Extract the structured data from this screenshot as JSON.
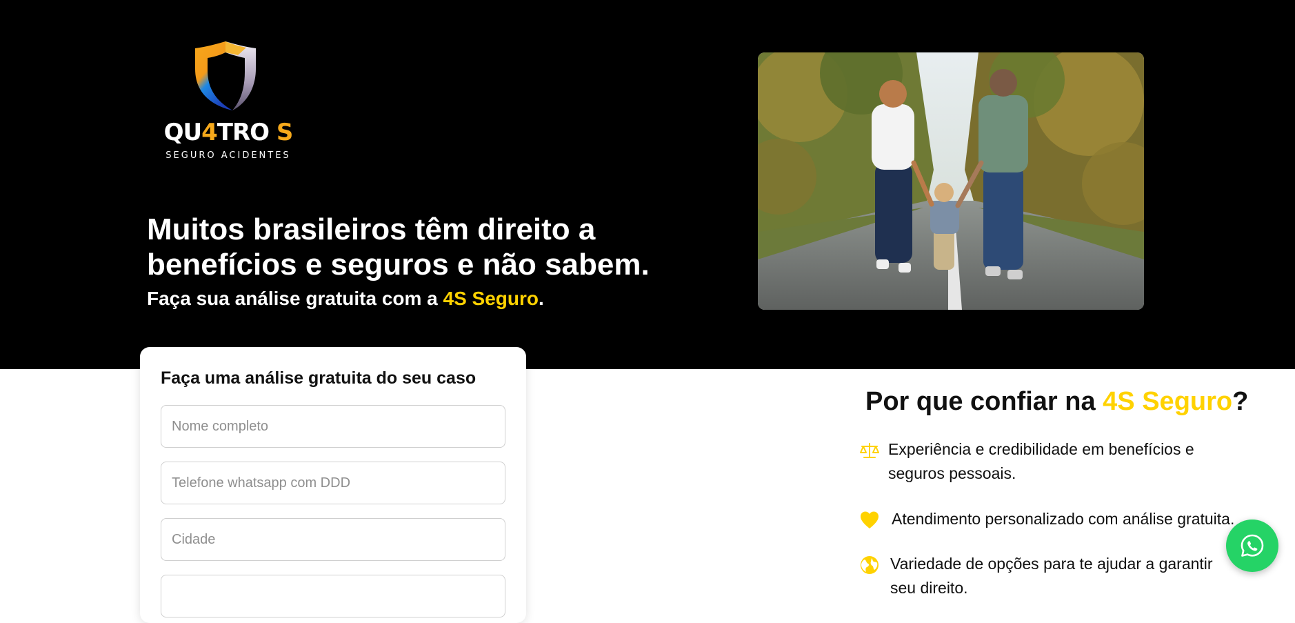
{
  "brand": {
    "logo_word_prefix": "QU",
    "logo_word_accent": "4",
    "logo_word_middle": "TRO ",
    "logo_word_suffix": "S",
    "logo_tagline": "SEGURO ACIDENTES"
  },
  "hero": {
    "headline": "Muitos brasileiros têm direito a benefícios e seguros e não sabem.",
    "subline_prefix": "Faça sua análise gratuita com a ",
    "subline_brand": "4S Seguro",
    "subline_suffix": ".",
    "photo_description": "family-walking-road-photo"
  },
  "form": {
    "title": "Faça uma análise gratuita do seu caso",
    "fields": [
      {
        "placeholder": "Nome completo",
        "value": ""
      },
      {
        "placeholder": "Telefone whatsapp com DDD",
        "value": ""
      },
      {
        "placeholder": "Cidade",
        "value": ""
      },
      {
        "placeholder": "",
        "value": ""
      }
    ]
  },
  "why": {
    "title_prefix": "Por que confiar na ",
    "title_brand": "4S Seguro",
    "title_suffix": "?",
    "items": [
      {
        "icon": "scale-icon",
        "text": "Experiência e credibilidade em benefícios e seguros pessoais."
      },
      {
        "icon": "heart-icon",
        "text": "Atendimento personalizado com análise gratuita."
      },
      {
        "icon": "globe-icon",
        "text": "Variedade de opções para te ajudar a garantir seu direito."
      }
    ]
  },
  "whatsapp": {
    "icon": "whatsapp-icon"
  },
  "colors": {
    "hero_bg": "#000000",
    "brand_yellow": "#ffd200",
    "logo_orange": "#f6a91b",
    "whatsapp_green": "#25d366",
    "text_dark": "#111111"
  }
}
